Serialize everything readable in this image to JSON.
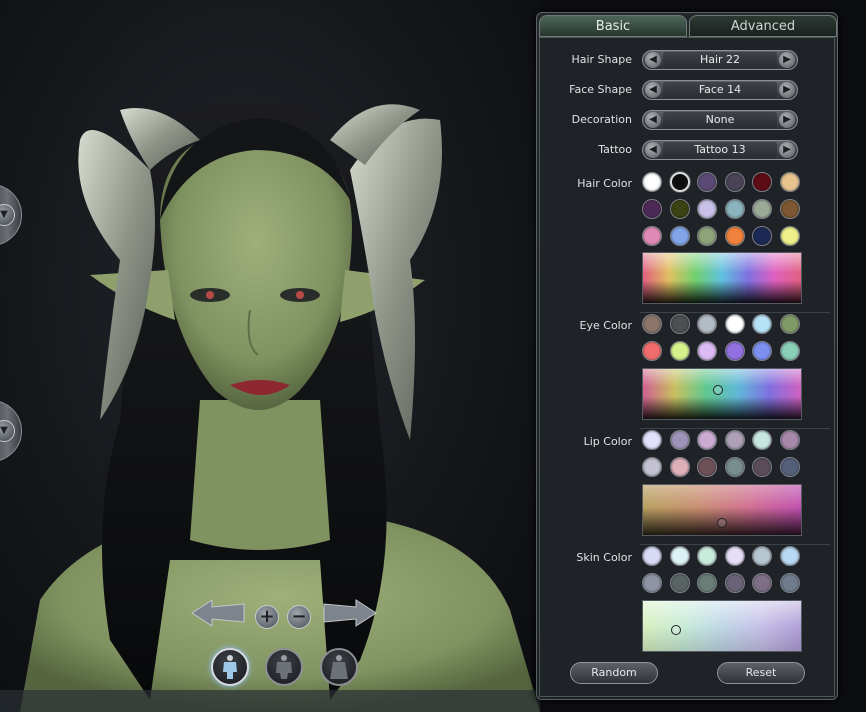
{
  "tabs": [
    {
      "label": "Basic",
      "active": true
    },
    {
      "label": "Advanced",
      "active": false
    }
  ],
  "selectors": [
    {
      "label": "Hair Shape",
      "value": "Hair 22"
    },
    {
      "label": "Face Shape",
      "value": "Face 14"
    },
    {
      "label": "Decoration",
      "value": "None"
    },
    {
      "label": "Tattoo",
      "value": "Tattoo 13"
    }
  ],
  "palettes": {
    "hair": {
      "label": "Hair Color",
      "selected_index": 1,
      "swatches": [
        "#ffffff",
        "#0d0d0d",
        "#5b4a74",
        "#4a4356",
        "#5c0d16",
        "#e8c58e",
        "#4d2a55",
        "#3b4214",
        "#c8c0e6",
        "#8ab3bd",
        "#9aaa96",
        "#7d5732",
        "#e08ab6",
        "#82a4e8",
        "#8ea37a",
        "#f0823e",
        "#1d2a55",
        "#eef08a"
      ]
    },
    "eye": {
      "label": "Eye Color",
      "swatches": [
        "#8c7468",
        "#4d4f52",
        "#b2bcc4",
        "#ffffff",
        "#b6e2f6",
        "#7f9a66",
        "#ee6c6c",
        "#d6f28a",
        "#dcbaf4",
        "#9270e0",
        "#7d8ff0",
        "#8ad0b8"
      ]
    },
    "lip": {
      "label": "Lip Color",
      "swatches": [
        "#e2e0fa",
        "#9e94ba",
        "#ccaad2",
        "#aea0b6",
        "#c8e6e0",
        "#a888aa",
        "#c4c2d2",
        "#deb0b8",
        "#6e5058",
        "#788e8c",
        "#5a4c58",
        "#54607a"
      ]
    },
    "skin": {
      "label": "Skin Color",
      "swatches": [
        "#d8daf6",
        "#dcf2f4",
        "#c8ecdc",
        "#e6def6",
        "#b6c6d0",
        "#b8d8f4",
        "#8e94a4",
        "#5a6464",
        "#6a7e78",
        "#6a6276",
        "#7e6e86",
        "#6e7c8e"
      ]
    }
  },
  "buttons": {
    "random": "Random",
    "reset": "Reset"
  },
  "viewport": {
    "rotate_icon": "chevron-down-icon",
    "zoom_in": "+",
    "zoom_out": "−"
  }
}
